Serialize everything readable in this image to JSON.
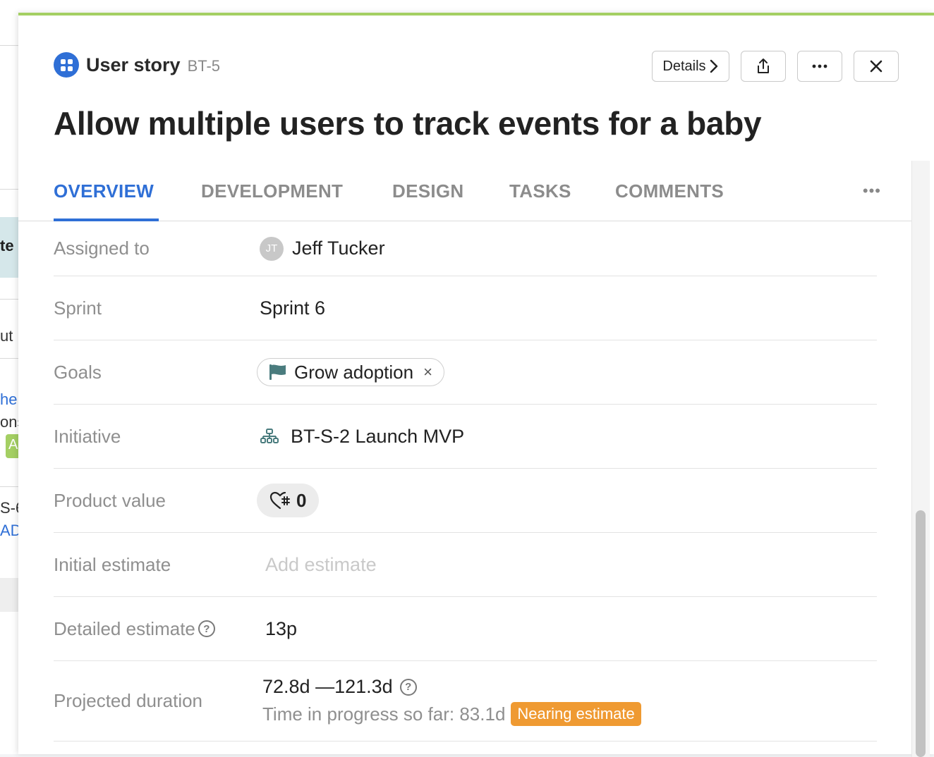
{
  "background": {
    "fragments": [
      "te",
      "ut",
      "he",
      "ons",
      "A",
      "S-6",
      "AD"
    ]
  },
  "header": {
    "type_icon": "user-story-grid-icon",
    "type_label": "User story",
    "key": "BT-5",
    "details_label": "Details",
    "title": "Allow multiple users to track events for a baby"
  },
  "tabs": [
    {
      "label": "OVERVIEW",
      "active": true
    },
    {
      "label": "DEVELOPMENT",
      "active": false
    },
    {
      "label": "DESIGN",
      "active": false
    },
    {
      "label": "TASKS",
      "active": false
    },
    {
      "label": "COMMENTS",
      "active": false
    }
  ],
  "tab_more": "•••",
  "fields": {
    "assigned": {
      "label": "Assigned to",
      "initials": "JT",
      "value": "Jeff Tucker"
    },
    "sprint": {
      "label": "Sprint",
      "value": "Sprint 6"
    },
    "goals": {
      "label": "Goals",
      "value": "Grow adoption",
      "remove": "×"
    },
    "initiative": {
      "label": "Initiative",
      "value": "BT-S-2 Launch MVP"
    },
    "product_value": {
      "label": "Product value",
      "value": "0"
    },
    "initial_estimate": {
      "label": "Initial estimate",
      "placeholder": "Add estimate"
    },
    "detailed_estimate": {
      "label": "Detailed estimate",
      "value": "13p"
    },
    "projected_duration": {
      "label": "Projected duration",
      "range": "72.8d —121.3d",
      "progress": "Time in progress so far: 83.1d",
      "badge": "Nearing estimate"
    }
  },
  "colors": {
    "accent": "#2f6fd6",
    "top_border": "#a4cf63",
    "badge": "#ef9a32",
    "goal_flag": "#4a7c7e"
  }
}
